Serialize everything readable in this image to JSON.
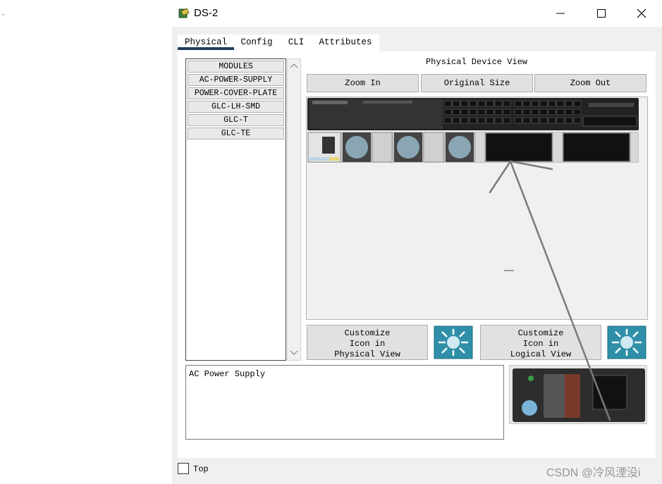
{
  "window": {
    "title": "DS-2",
    "colors": {
      "accent": "#1f3b5c",
      "panel": "#ffffff",
      "chrome": "#f0f0f0"
    }
  },
  "tabs": [
    {
      "label": "Physical",
      "selected": true
    },
    {
      "label": "Config",
      "selected": false
    },
    {
      "label": "CLI",
      "selected": false
    },
    {
      "label": "Attributes",
      "selected": false
    }
  ],
  "modules": {
    "items": [
      "MODULES",
      "AC-POWER-SUPPLY",
      "POWER-COVER-PLATE",
      "GLC-LH-SMD",
      "GLC-T",
      "GLC-TE"
    ]
  },
  "physical_view": {
    "title": "Physical Device View",
    "zoom_in": "Zoom In",
    "original_size": "Original Size",
    "zoom_out": "Zoom Out"
  },
  "customize": {
    "physical": "Customize\nIcon in\nPhysical View",
    "logical": "Customize\nIcon in\nLogical View"
  },
  "description": "AC Power Supply",
  "footer": {
    "top_label": "Top",
    "top_checked": false
  },
  "watermark": "CSDN @冷风湮没i"
}
